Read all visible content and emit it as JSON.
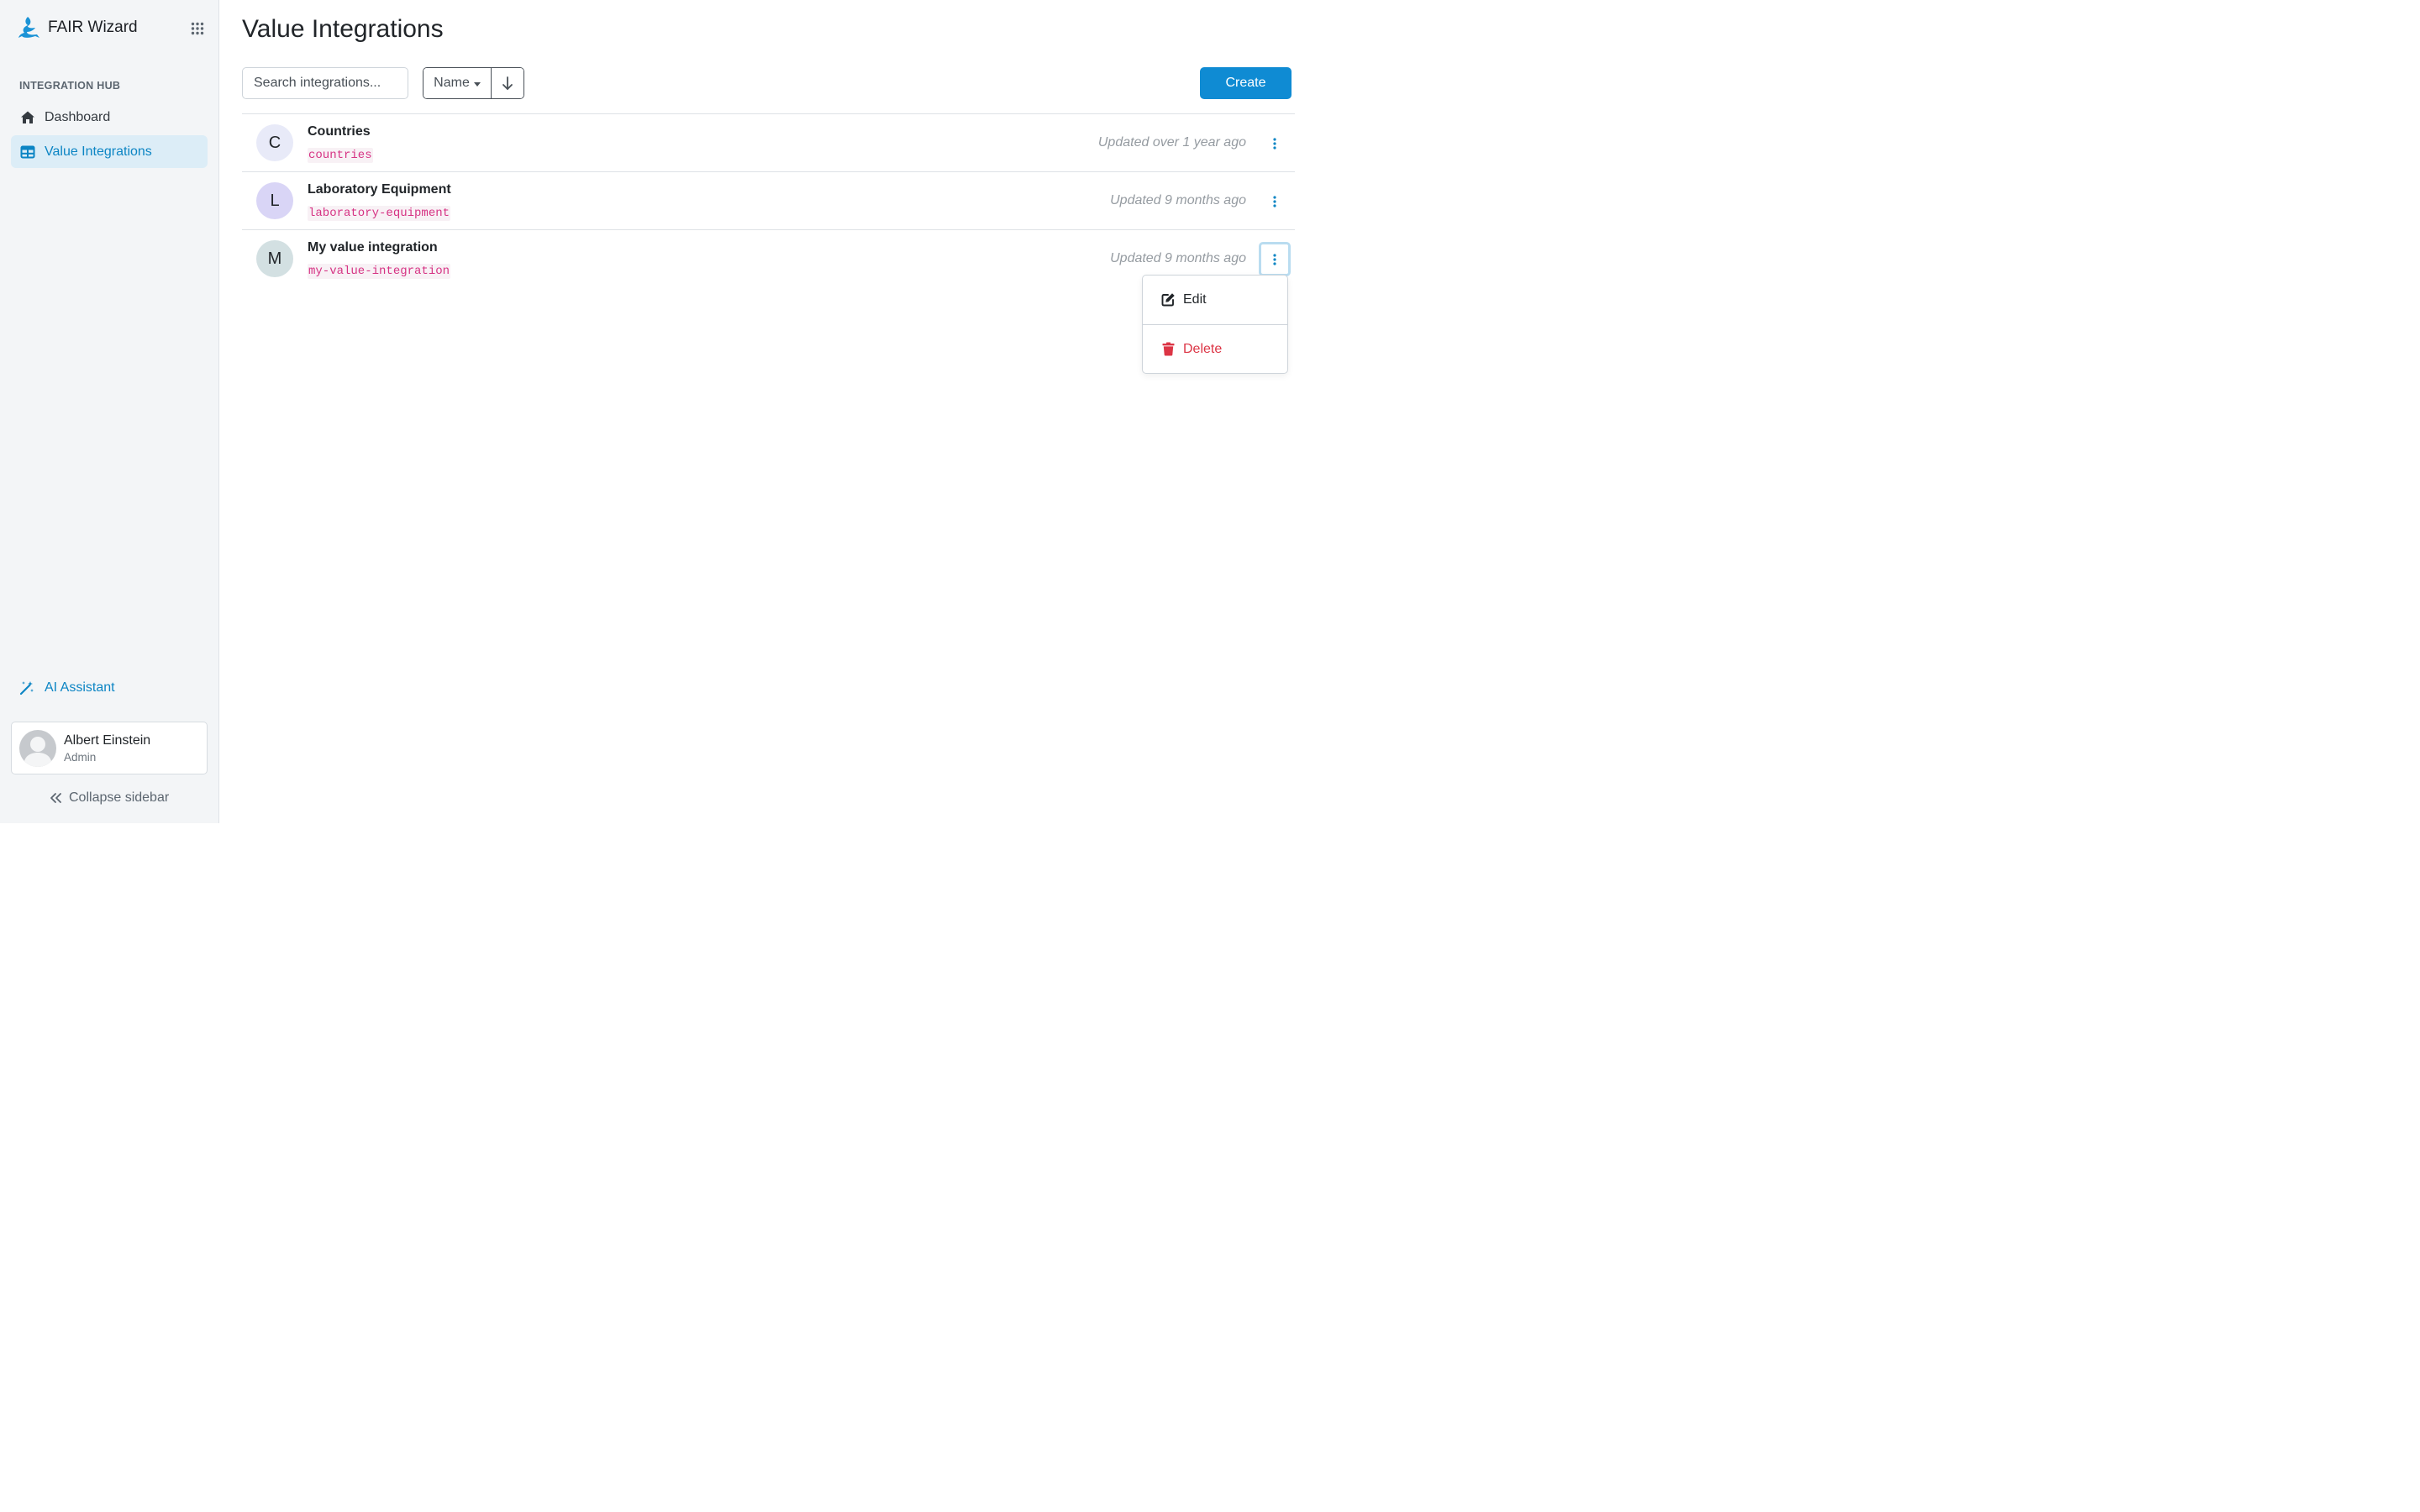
{
  "app": {
    "name": "FAIR Wizard"
  },
  "sidebar": {
    "section_title": "INTEGRATION HUB",
    "items": [
      {
        "label": "Dashboard",
        "icon": "home-icon",
        "active": false
      },
      {
        "label": "Value Integrations",
        "icon": "table-icon",
        "active": true
      }
    ],
    "ai_assistant": {
      "label": "AI Assistant",
      "icon": "magic-wand-icon"
    },
    "user": {
      "name": "Albert Einstein",
      "role": "Admin"
    },
    "collapse_label": "Collapse sidebar"
  },
  "page": {
    "title": "Value Integrations"
  },
  "toolbar": {
    "search_placeholder": "Search integrations...",
    "sort_label": "Name",
    "sort_direction": "descending",
    "create_label": "Create"
  },
  "integrations": [
    {
      "initial": "C",
      "name": "Countries",
      "id": "countries",
      "updated": "Updated over 1 year ago",
      "avatar_color": "#e8eaf8"
    },
    {
      "initial": "L",
      "name": "Laboratory Equipment",
      "id": "laboratory-equipment",
      "updated": "Updated 9 months ago",
      "avatar_color": "#d9d5f6"
    },
    {
      "initial": "M",
      "name": "My value integration",
      "id": "my-value-integration",
      "updated": "Updated 9 months ago",
      "avatar_color": "#d3e0e2"
    }
  ],
  "dropdown": {
    "edit_label": "Edit",
    "delete_label": "Delete"
  },
  "colors": {
    "accent": "#0f8bd3",
    "danger": "#dc3545",
    "code": "#d63384"
  }
}
